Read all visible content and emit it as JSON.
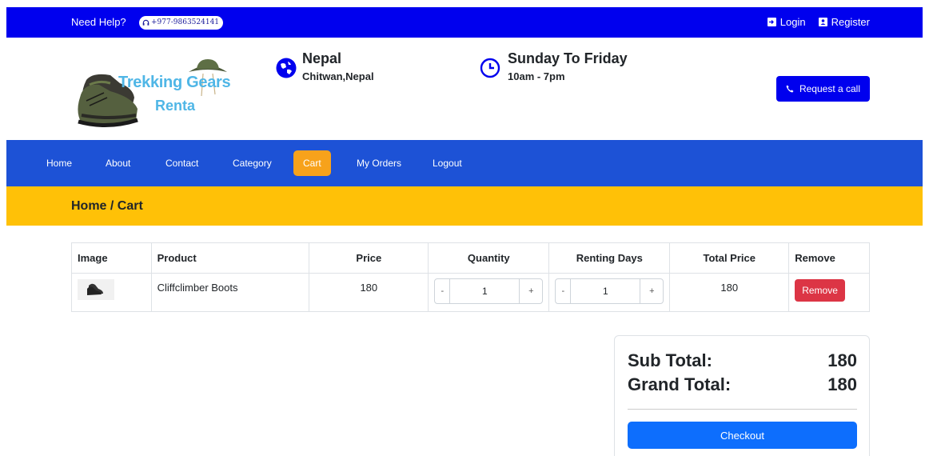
{
  "topbar": {
    "help_label": "Need Help?",
    "phone": "+977-9863524141",
    "login_label": "Login",
    "register_label": "Register"
  },
  "header": {
    "logo_line1": "Trekking Gears",
    "logo_line2": "Renta",
    "location_title": "Nepal",
    "location_sub": "Chitwan,Nepal",
    "hours_title": "Sunday To Friday",
    "hours_sub": "10am - 7pm",
    "call_button": "Request a call"
  },
  "nav": {
    "items": [
      {
        "label": "Home"
      },
      {
        "label": "About"
      },
      {
        "label": "Contact"
      },
      {
        "label": "Category"
      },
      {
        "label": "Cart"
      },
      {
        "label": "My Orders"
      },
      {
        "label": "Logout"
      }
    ],
    "active": "Cart"
  },
  "breadcrumb": "Home / Cart",
  "table": {
    "headers": [
      "Image",
      "Product",
      "Price",
      "Quantity",
      "Renting Days",
      "Total Price",
      "Remove"
    ],
    "rows": [
      {
        "product": "Cliffclimber Boots",
        "price": "180",
        "quantity": "1",
        "renting_days": "1",
        "total": "180",
        "remove_label": "Remove",
        "stepper_minus": "-",
        "stepper_plus": "+"
      }
    ]
  },
  "summary": {
    "subtotal_label": "Sub Total:",
    "subtotal_value": "180",
    "grand_label": "Grand Total:",
    "grand_value": "180",
    "checkout_label": "Checkout"
  },
  "colors": {
    "topbar": "#0000ee",
    "nav": "#1d52d6",
    "active_nav": "#f7a21b",
    "breadcrumb": "#ffc107",
    "remove": "#dc3545",
    "checkout": "#0d6efd"
  }
}
